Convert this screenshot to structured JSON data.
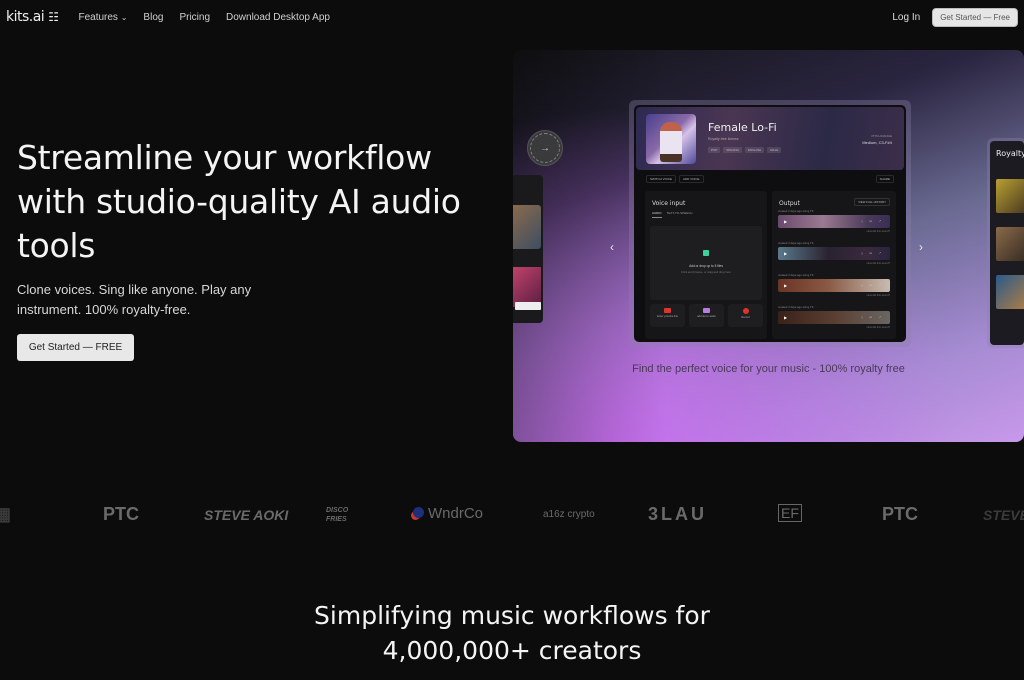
{
  "nav": {
    "logo": "kits.ai",
    "logo_mark": "☷",
    "links": [
      {
        "label": "Features",
        "has_dropdown": true
      },
      {
        "label": "Blog"
      },
      {
        "label": "Pricing"
      },
      {
        "label": "Download Desktop App"
      }
    ],
    "dropdown_glyph": "⌄",
    "login": "Log In",
    "cta": "Get Started — Free"
  },
  "hero": {
    "title": "Streamline your workflow with studio-quality AI audio tools",
    "subtitle": "Clone voices. Sing like anyone. Play any instrument.  100% royalty-free.",
    "cta": "Get Started — FREE"
  },
  "showcase": {
    "try_badge": "TRY IT OUT",
    "try_arrow": "→",
    "prev": "‹",
    "next": "›",
    "left_card_button": "CONTINUE",
    "caption": "Find the perfect voice for your music - 100% royalty free",
    "app": {
      "voice_name": "Female Lo-Fi",
      "license": "Royalty-free license",
      "tags": [
        "POP",
        "SINGING",
        "ENGLISH",
        "MALE"
      ],
      "pitch_label": "PITCH RANGE",
      "pitch_value": "Medium, C3-F#4",
      "toolbar": [
        "SWITCH VOICE",
        "ADD VOICE"
      ],
      "share": "SHARE",
      "voice_input": {
        "title": "Voice input",
        "tabs": [
          "AUDIO",
          "TEXT-TO-SPEECH"
        ],
        "drop_title": "Add or drop up to 5 files",
        "drop_hint": "Click and browse, or drag and drop here",
        "sources": [
          {
            "label": "Enter youtube link",
            "icon": "youtube-icon"
          },
          {
            "label": "add demo audio",
            "icon": "music-note-icon"
          },
          {
            "label": "Record",
            "icon": "record-icon"
          }
        ]
      },
      "output": {
        "title": "Output",
        "view_history": "VIEW FULL HISTORY",
        "items": [
          {
            "meta": "created 2 days ago using TK",
            "feedback": "How did this sound?"
          },
          {
            "meta": "created 3 days ago using TK",
            "feedback": "How did this sound?"
          },
          {
            "meta": "created 3 days ago using TK",
            "feedback": "How did this sound?"
          },
          {
            "meta": "created 3 days ago using TK",
            "feedback": "How did this sound?"
          }
        ],
        "play_glyph": "▶",
        "actions_glyph": "⤓ ☷ ↗"
      }
    },
    "right_card_title": "Royalty"
  },
  "logos": [
    "PTC",
    "STEVE AOKI",
    "DISCO FRIES",
    "WndrCo",
    "a16z crypto",
    "3LAU",
    "EF",
    "PTC",
    "STEVE AOKI"
  ],
  "section": {
    "title": "Simplifying music workflows for 4,000,000+ creators"
  }
}
